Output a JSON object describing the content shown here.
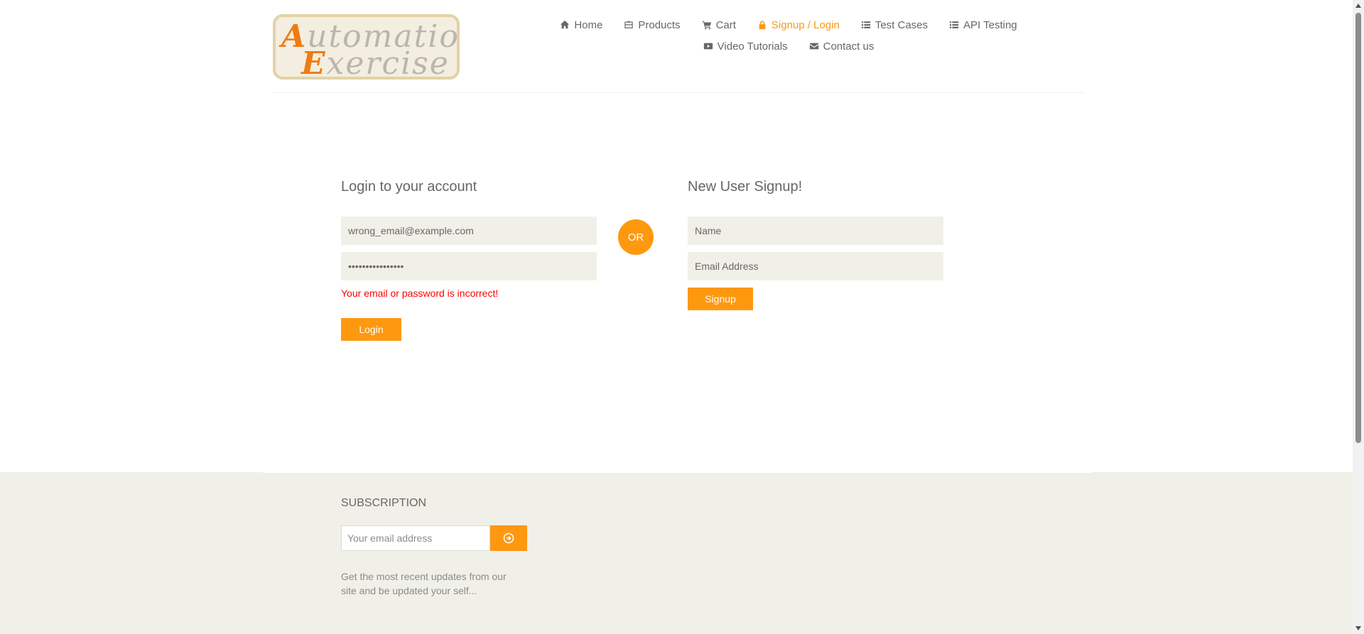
{
  "brand": {
    "line1_first": "A",
    "line1_rest": "utomation",
    "line2_first": "E",
    "line2_rest": "xercise"
  },
  "nav": {
    "items": [
      {
        "label": "Home",
        "icon": "home-icon"
      },
      {
        "label": "Products",
        "icon": "briefcase-icon"
      },
      {
        "label": "Cart",
        "icon": "cart-icon"
      },
      {
        "label": "Signup / Login",
        "icon": "lock-icon",
        "active": true
      },
      {
        "label": "Test Cases",
        "icon": "list-icon"
      },
      {
        "label": "API Testing",
        "icon": "list-icon"
      },
      {
        "label": "Video Tutorials",
        "icon": "youtube-play-icon"
      },
      {
        "label": "Contact us",
        "icon": "envelope-icon"
      }
    ]
  },
  "login": {
    "title": "Login to your account",
    "email_value": "wrong_email@example.com",
    "password_value": "••••••••••••••••",
    "error": "Your email or password is incorrect!",
    "button": "Login"
  },
  "or_label": "OR",
  "signup": {
    "title": "New User Signup!",
    "name_placeholder": "Name",
    "email_placeholder": "Email Address",
    "button": "Signup"
  },
  "footer": {
    "subscription_title": "SUBSCRIPTION",
    "email_placeholder": "Your email address",
    "note": "Get the most recent updates from our site and be updated your self..."
  },
  "colors": {
    "accent": "#fe980f",
    "error": "#ff0000",
    "field_bg": "#f0f0e9",
    "text": "#696763"
  }
}
